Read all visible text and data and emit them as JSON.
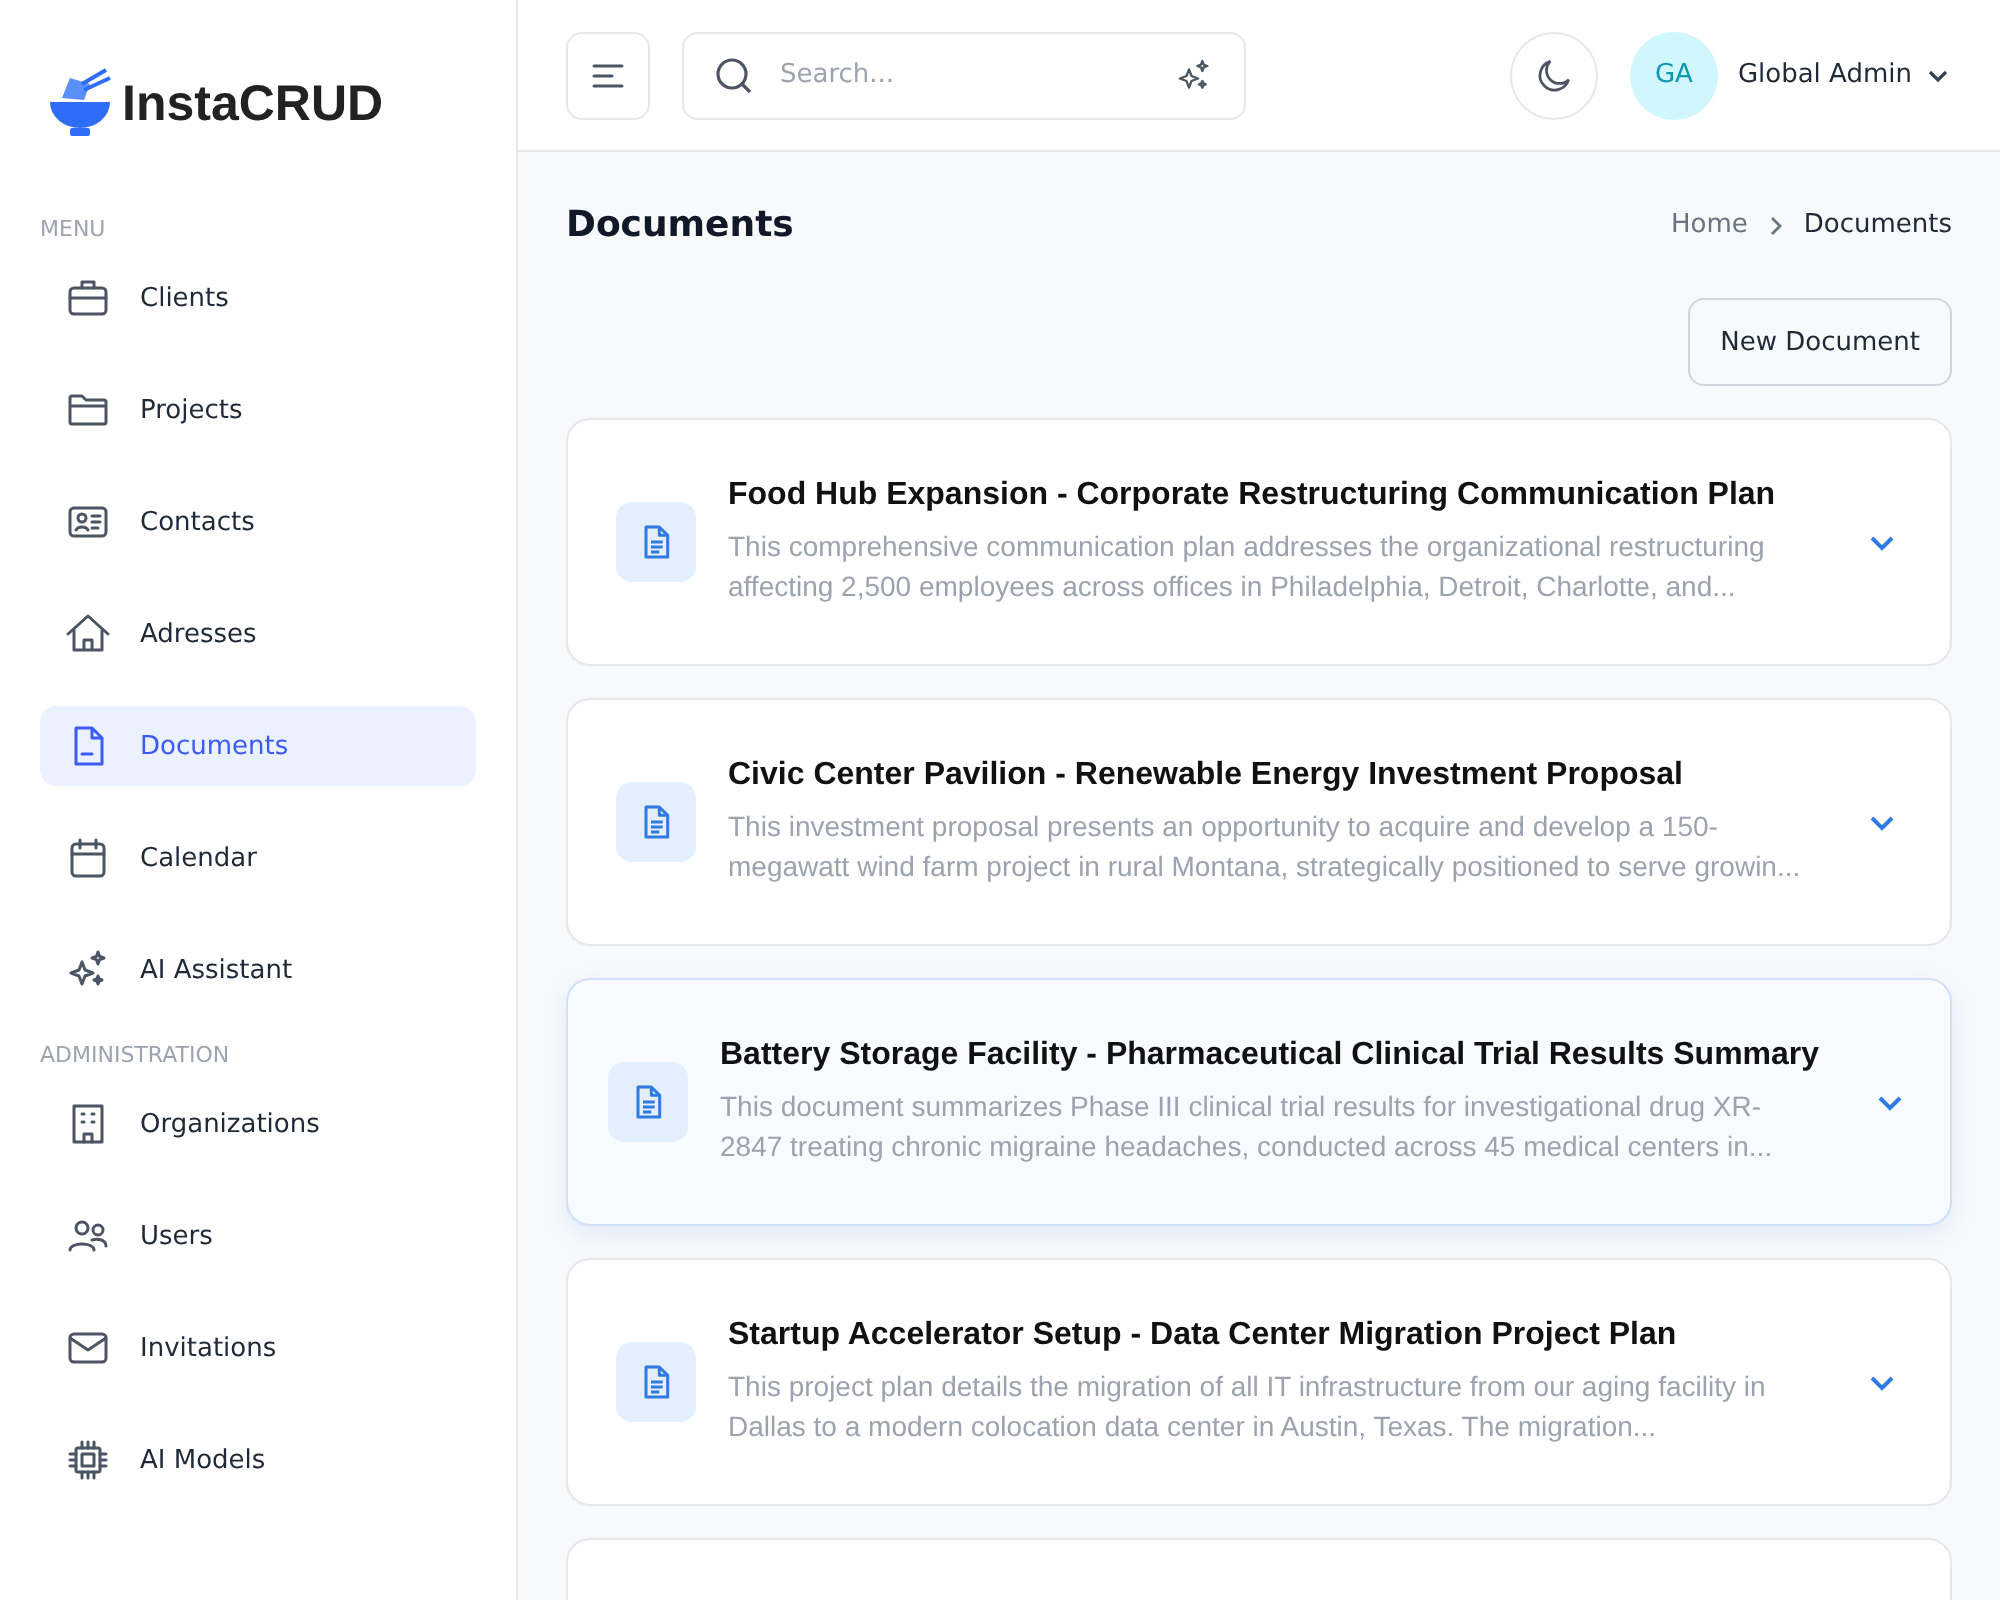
{
  "sidebar": {
    "logo": "InstaCRUD",
    "sections": [
      {
        "label": "MENU",
        "items": [
          {
            "label": "Clients",
            "selected": false
          },
          {
            "label": "Projects",
            "selected": false
          },
          {
            "label": "Contacts",
            "selected": false
          },
          {
            "label": "Adresses",
            "selected": false
          },
          {
            "label": "Documents",
            "selected": true
          },
          {
            "label": "Calendar",
            "selected": false
          },
          {
            "label": "AI Assistant",
            "selected": false
          }
        ]
      },
      {
        "label": "ADMINISTRATION",
        "items": [
          {
            "label": "Organizations",
            "selected": false
          },
          {
            "label": "Users",
            "selected": false
          },
          {
            "label": "Invitations",
            "selected": false
          },
          {
            "label": "AI Models",
            "selected": false
          }
        ]
      }
    ]
  },
  "header": {
    "search": {
      "placeholder": "Search..."
    },
    "user": {
      "initials": "GA",
      "name": "Global Admin"
    }
  },
  "page": {
    "title": "Documents",
    "breadcrumb": [
      "Home",
      "Documents"
    ],
    "new_button": "New Document"
  },
  "documents": [
    {
      "title": "Food Hub Expansion - Corporate Restructuring Communication Plan",
      "description": "This comprehensive communication plan addresses the organizational restructuring affecting 2,500 employees across offices in Philadelphia, Detroit, Charlotte, and...",
      "hovered": false
    },
    {
      "title": "Civic Center Pavilion - Renewable Energy Investment Proposal",
      "description": "This investment proposal presents an opportunity to acquire and develop a 150-megawatt wind farm project in rural Montana, strategically positioned to serve growin...",
      "hovered": false
    },
    {
      "title": "Battery Storage Facility - Pharmaceutical Clinical Trial Results Summary",
      "description": "This document summarizes Phase III clinical trial results for investigational drug XR-2847 treating chronic migraine headaches, conducted across 45 medical centers in...",
      "hovered": true
    },
    {
      "title": "Startup Accelerator Setup - Data Center Migration Project Plan",
      "description": "This project plan details the migration of all IT infrastructure from our aging facility in Dallas to a modern colocation data center in Austin, Texas. The migration...",
      "hovered": false
    }
  ]
}
